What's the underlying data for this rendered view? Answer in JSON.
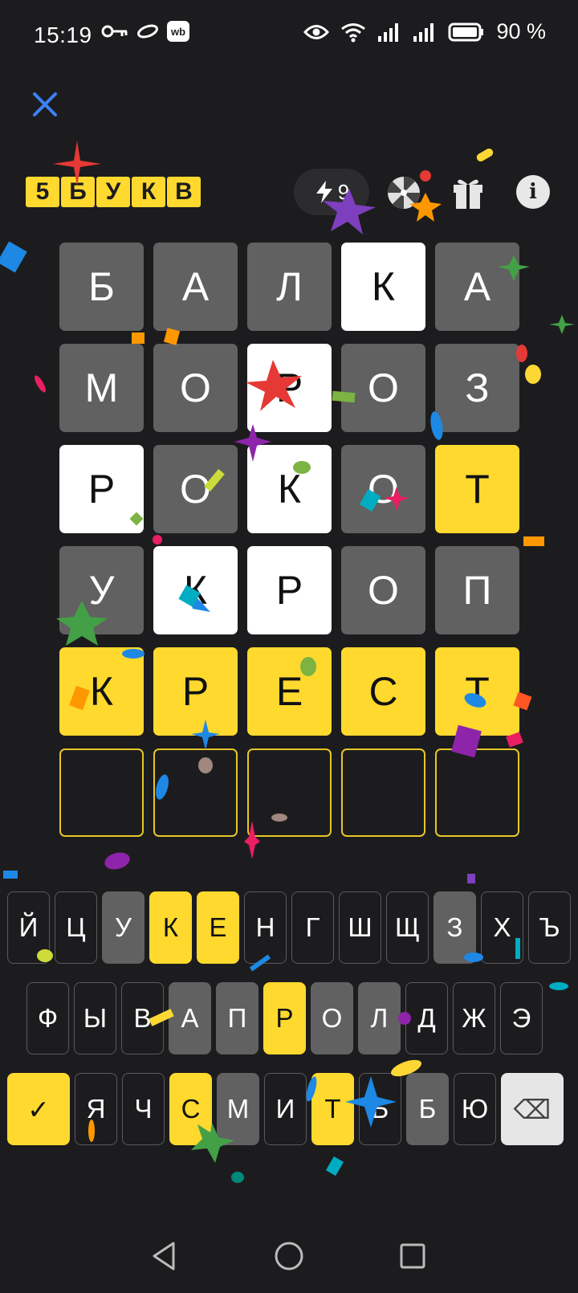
{
  "status_bar": {
    "time": "15:19",
    "battery_text": "90 %",
    "wb_badge": "wb",
    "icons": [
      "key-icon",
      "oval-icon",
      "wb-icon",
      "eye-icon",
      "wifi-icon",
      "signal-icon",
      "signal-icon-2",
      "battery-icon"
    ]
  },
  "header": {
    "logo_letters": [
      "5",
      "Б",
      "У",
      "К",
      "В"
    ],
    "energy_count": "9",
    "info_label": "i"
  },
  "grid": {
    "rows": [
      [
        {
          "letter": "Б",
          "state": "absent"
        },
        {
          "letter": "А",
          "state": "absent"
        },
        {
          "letter": "Л",
          "state": "absent"
        },
        {
          "letter": "К",
          "state": "present"
        },
        {
          "letter": "А",
          "state": "absent"
        }
      ],
      [
        {
          "letter": "М",
          "state": "absent"
        },
        {
          "letter": "О",
          "state": "absent"
        },
        {
          "letter": "Р",
          "state": "present"
        },
        {
          "letter": "О",
          "state": "absent"
        },
        {
          "letter": "З",
          "state": "absent"
        }
      ],
      [
        {
          "letter": "Р",
          "state": "present"
        },
        {
          "letter": "О",
          "state": "absent"
        },
        {
          "letter": "К",
          "state": "present"
        },
        {
          "letter": "О",
          "state": "absent"
        },
        {
          "letter": "Т",
          "state": "correct"
        }
      ],
      [
        {
          "letter": "У",
          "state": "absent"
        },
        {
          "letter": "К",
          "state": "present"
        },
        {
          "letter": "Р",
          "state": "present"
        },
        {
          "letter": "О",
          "state": "absent"
        },
        {
          "letter": "П",
          "state": "absent"
        }
      ],
      [
        {
          "letter": "К",
          "state": "correct"
        },
        {
          "letter": "Р",
          "state": "correct"
        },
        {
          "letter": "Е",
          "state": "correct"
        },
        {
          "letter": "С",
          "state": "correct"
        },
        {
          "letter": "Т",
          "state": "correct"
        }
      ],
      [
        {
          "letter": "",
          "state": "empty"
        },
        {
          "letter": "",
          "state": "empty"
        },
        {
          "letter": "",
          "state": "empty"
        },
        {
          "letter": "",
          "state": "empty"
        },
        {
          "letter": "",
          "state": "empty"
        }
      ]
    ]
  },
  "keyboard": {
    "rows": [
      [
        {
          "k": "Й",
          "s": "unused"
        },
        {
          "k": "Ц",
          "s": "unused"
        },
        {
          "k": "У",
          "s": "absent"
        },
        {
          "k": "К",
          "s": "correct"
        },
        {
          "k": "Е",
          "s": "correct"
        },
        {
          "k": "Н",
          "s": "unused"
        },
        {
          "k": "Г",
          "s": "unused"
        },
        {
          "k": "Ш",
          "s": "unused"
        },
        {
          "k": "Щ",
          "s": "unused"
        },
        {
          "k": "З",
          "s": "absent"
        },
        {
          "k": "Х",
          "s": "unused"
        },
        {
          "k": "Ъ",
          "s": "unused"
        }
      ],
      [
        {
          "k": "Ф",
          "s": "unused"
        },
        {
          "k": "Ы",
          "s": "unused"
        },
        {
          "k": "В",
          "s": "unused"
        },
        {
          "k": "А",
          "s": "absent"
        },
        {
          "k": "П",
          "s": "absent"
        },
        {
          "k": "Р",
          "s": "correct"
        },
        {
          "k": "О",
          "s": "absent"
        },
        {
          "k": "Л",
          "s": "absent"
        },
        {
          "k": "Д",
          "s": "unused"
        },
        {
          "k": "Ж",
          "s": "unused"
        },
        {
          "k": "Э",
          "s": "unused"
        }
      ],
      [
        {
          "k": "✓",
          "s": "enter"
        },
        {
          "k": "Я",
          "s": "unused"
        },
        {
          "k": "Ч",
          "s": "unused"
        },
        {
          "k": "С",
          "s": "correct"
        },
        {
          "k": "М",
          "s": "absent"
        },
        {
          "k": "И",
          "s": "unused"
        },
        {
          "k": "Т",
          "s": "correct"
        },
        {
          "k": "Ь",
          "s": "unused"
        },
        {
          "k": "Б",
          "s": "absent"
        },
        {
          "k": "Ю",
          "s": "unused"
        },
        {
          "k": "⌫",
          "s": "backspace"
        }
      ]
    ]
  },
  "colors": {
    "background": "#1c1c1e",
    "absent": "#616161",
    "present": "#ffffff",
    "correct": "#ffd92e",
    "close_icon": "#3b82f6"
  }
}
